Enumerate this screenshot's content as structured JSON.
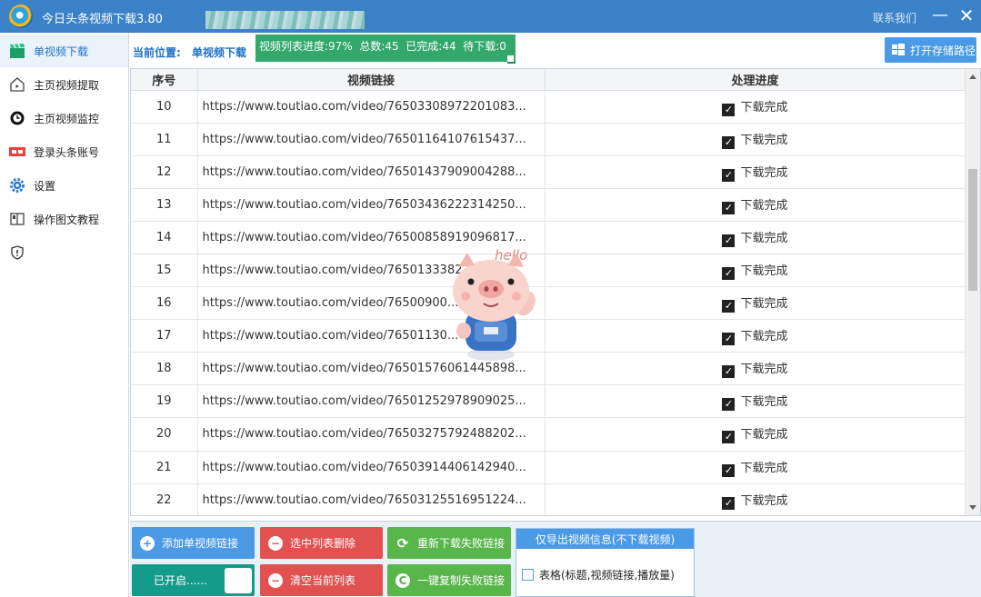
{
  "app": {
    "title": "今日头条视频下载3.80",
    "contact_label": "联系我们",
    "minimize_glyph": "—",
    "close_glyph": "✕"
  },
  "sidebar": {
    "items": [
      {
        "label": "单视频下载",
        "icon": "clapperboard-icon",
        "active": true
      },
      {
        "label": "主页视频提取",
        "icon": "home-play-icon",
        "active": false
      },
      {
        "label": "主页视频监控",
        "icon": "monitor-clock-icon",
        "active": false
      },
      {
        "label": "登录头条账号",
        "icon": "toutiao-logo-icon",
        "active": false
      },
      {
        "label": "设置",
        "icon": "gear-icon",
        "active": false
      },
      {
        "label": "操作图文教程",
        "icon": "book-icon",
        "active": false
      },
      {
        "label": "",
        "icon": "shield-icon",
        "active": false
      }
    ]
  },
  "header": {
    "location_label": "当前位置:",
    "location_value": "单视频下载",
    "progress_text": "视频列表进度:97%  总数:45  已完成:44  待下载:0",
    "progress_fraction": 0.97,
    "open_folder_label": "打开存储路径"
  },
  "table": {
    "columns": [
      "序号",
      "视频链接",
      "处理进度"
    ],
    "rows": [
      {
        "index": "10",
        "url": "https://www.toutiao.com/video/76503308972201083...",
        "status": "下载完成"
      },
      {
        "index": "11",
        "url": "https://www.toutiao.com/video/76501164107615437...",
        "status": "下载完成"
      },
      {
        "index": "12",
        "url": "https://www.toutiao.com/video/76501437909004288...",
        "status": "下载完成"
      },
      {
        "index": "13",
        "url": "https://www.toutiao.com/video/76503436222314250...",
        "status": "下载完成"
      },
      {
        "index": "14",
        "url": "https://www.toutiao.com/video/76500858919096817...",
        "status": "下载完成"
      },
      {
        "index": "15",
        "url": "https://www.toutiao.com/video/765013338220040...",
        "status": "下载完成"
      },
      {
        "index": "16",
        "url": "https://www.toutiao.com/video/76500900...",
        "status": "下载完成"
      },
      {
        "index": "17",
        "url": "https://www.toutiao.com/video/76501130...",
        "status": "下载完成"
      },
      {
        "index": "18",
        "url": "https://www.toutiao.com/video/76501576061445898...",
        "status": "下载完成"
      },
      {
        "index": "19",
        "url": "https://www.toutiao.com/video/76501252978909025...",
        "status": "下载完成"
      },
      {
        "index": "20",
        "url": "https://www.toutiao.com/video/76503275792488202...",
        "status": "下载完成"
      },
      {
        "index": "21",
        "url": "https://www.toutiao.com/video/76503914406142940...",
        "status": "下载完成"
      },
      {
        "index": "22",
        "url": "https://www.toutiao.com/video/76503125516951224...",
        "status": "下载完成"
      }
    ]
  },
  "mascot": {
    "caption": "hello"
  },
  "toolbar": {
    "add_link": "添加单视频链接",
    "delete_selected": "选中列表删除",
    "redownload_failed": "重新下载失败链接",
    "auto_on": "已开启......",
    "clear_list": "清空当前列表",
    "copy_failed": "一键复制失败链接",
    "export_title": "仅导出视频信息(不下载视频)",
    "export_option": "表格(标题,视频链接,播放量)"
  },
  "colors": {
    "titlebar": "#3b82c9",
    "accent_blue": "#4a9ae6",
    "progress_green": "#33a86b",
    "danger_red": "#e15150",
    "action_green": "#58b64a",
    "teal": "#159b8a"
  }
}
